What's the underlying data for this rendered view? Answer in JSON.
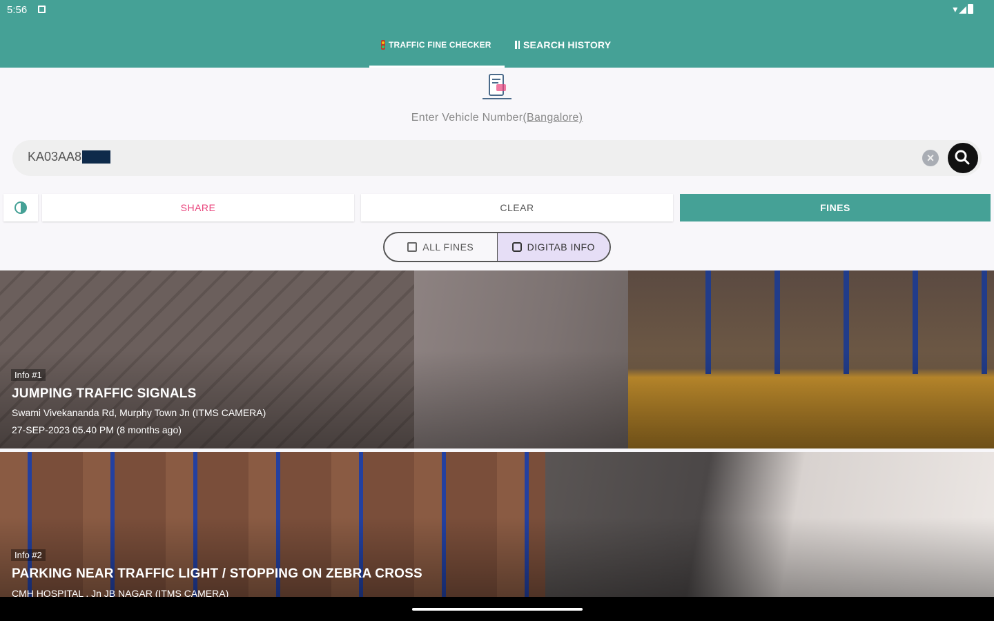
{
  "status_bar": {
    "time": "5:56"
  },
  "tabs": [
    {
      "label": "TRAFFIC FINE CHECKER",
      "icon": "traffic-light-icon",
      "selected": true
    },
    {
      "label": "SEARCH HISTORY",
      "icon": "list-icon",
      "selected": false
    }
  ],
  "prompt": {
    "text": "Enter Vehicle Number",
    "region": "(Bangalore)"
  },
  "search": {
    "value": "KA03AA8"
  },
  "actions": {
    "share": "SHARE",
    "clear": "CLEAR",
    "fines": "FINES"
  },
  "toggle": {
    "all_fines": "ALL FINES",
    "digitab_info": "DIGITAB INFO",
    "selected": "DIGITAB INFO"
  },
  "fines": [
    {
      "tag": "Info #1",
      "title": "JUMPING TRAFFIC SIGNALS",
      "location": "Swami Vivekananda Rd, Murphy Town Jn (ITMS CAMERA)",
      "datetime": "27-SEP-2023 05.40 PM (8 months ago)"
    },
    {
      "tag": "Info #2",
      "title": "PARKING NEAR TRAFFIC LIGHT / STOPPING ON ZEBRA CROSS",
      "location": "CMH HOSPITAL , Jn JB NAGAR (ITMS CAMERA)"
    }
  ],
  "colors": {
    "primary": "#45a196",
    "share": "#e9417a",
    "toggle_active": "#e6def6"
  }
}
